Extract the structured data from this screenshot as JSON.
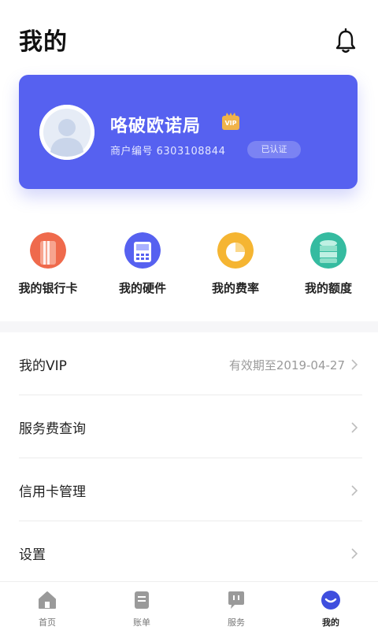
{
  "header": {
    "title": "我的",
    "bell_icon": "bell-icon"
  },
  "profile": {
    "name": "咯破欧诺局",
    "vip_badge": "VIP",
    "merchant_id": "商户编号 6303108844",
    "verified": "已认证",
    "card_color": "#5661f0"
  },
  "quick_actions": [
    {
      "label": "我的银行卡",
      "icon": "bank-card-icon",
      "color": "#ef6a4c"
    },
    {
      "label": "我的硬件",
      "icon": "hardware-icon",
      "color": "#5661f0"
    },
    {
      "label": "我的费率",
      "icon": "rate-pie-icon",
      "color": "#f5b532"
    },
    {
      "label": "我的额度",
      "icon": "quota-stack-icon",
      "color": "#35bba0"
    }
  ],
  "menu": [
    {
      "label": "我的VIP",
      "value": "有效期至2019-04-27"
    },
    {
      "label": "服务费查询",
      "value": ""
    },
    {
      "label": "信用卡管理",
      "value": ""
    },
    {
      "label": "设置",
      "value": ""
    }
  ],
  "tabbar": [
    {
      "label": "首页",
      "icon": "home-icon",
      "active": false
    },
    {
      "label": "账单",
      "icon": "bill-icon",
      "active": false
    },
    {
      "label": "服务",
      "icon": "service-icon",
      "active": false
    },
    {
      "label": "我的",
      "icon": "profile-icon",
      "active": true
    }
  ]
}
